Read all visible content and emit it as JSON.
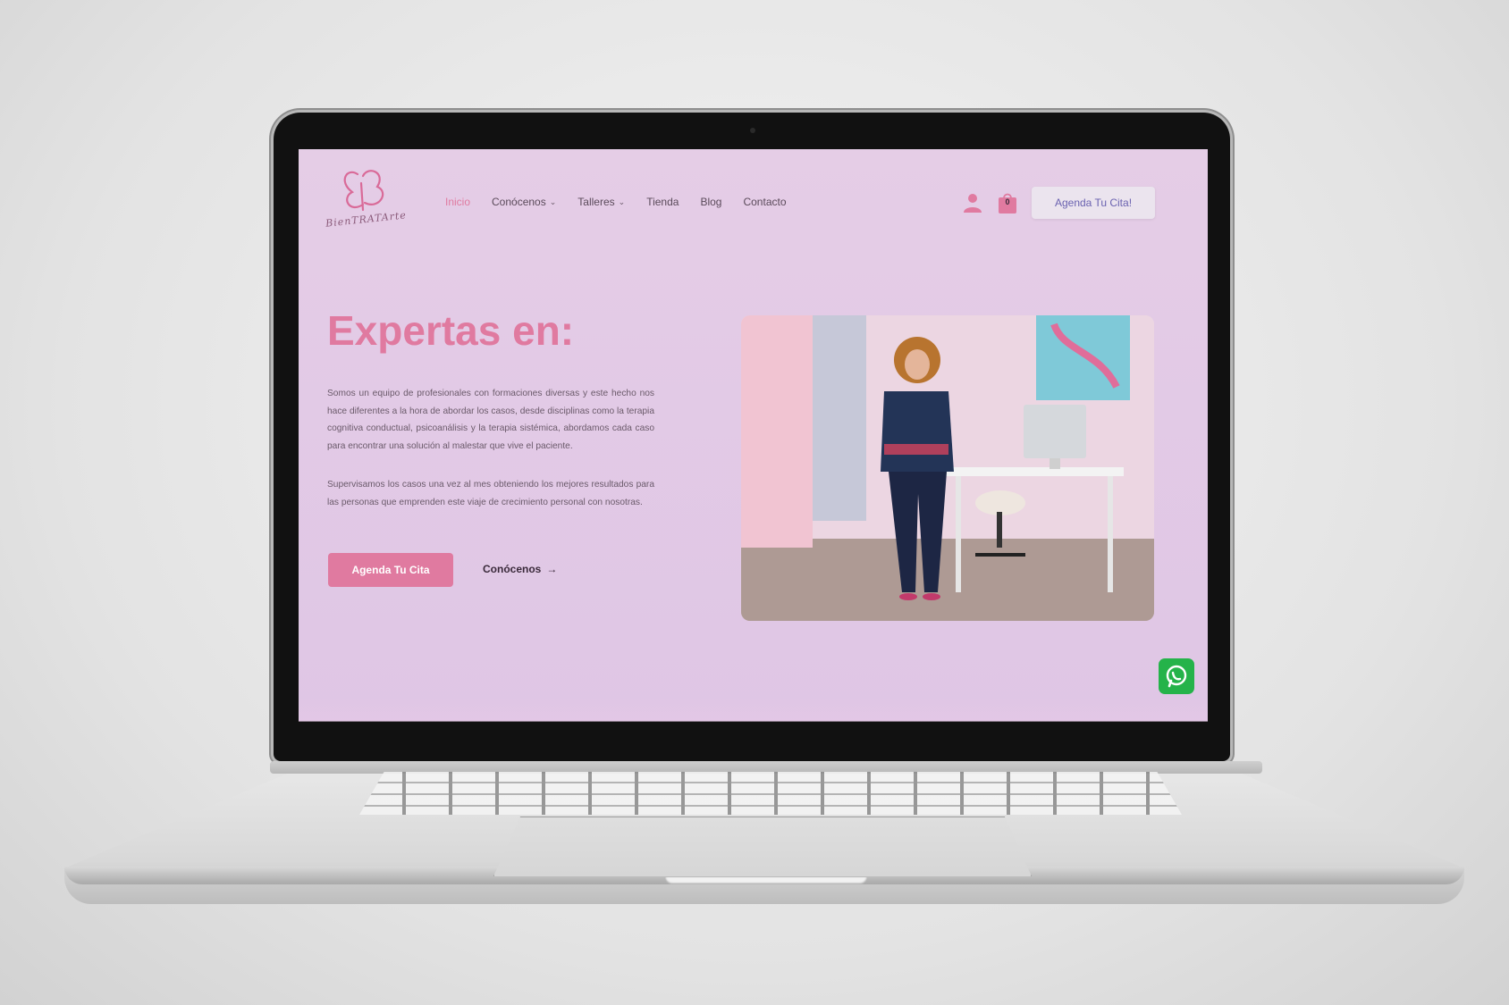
{
  "brand": {
    "logo_text": "BienTRATArte"
  },
  "nav": {
    "items": [
      {
        "label": "Inicio",
        "active": true,
        "has_dropdown": false
      },
      {
        "label": "Conócenos",
        "active": false,
        "has_dropdown": true
      },
      {
        "label": "Talleres",
        "active": false,
        "has_dropdown": true
      },
      {
        "label": "Tienda",
        "active": false,
        "has_dropdown": false
      },
      {
        "label": "Blog",
        "active": false,
        "has_dropdown": false
      },
      {
        "label": "Contacto",
        "active": false,
        "has_dropdown": false
      }
    ],
    "cart_count": "0",
    "cta_label": "Agenda Tu Cita!"
  },
  "hero": {
    "headline": "Expertas en:",
    "paragraph_1": "Somos un equipo de profesionales con formaciones diversas y este hecho nos hace diferentes a la hora de abordar los casos, desde disciplinas como la terapia cognitiva conductual, psicoanálisis y la terapia sistémica, abordamos cada caso para encontrar una solución al malestar que vive el paciente.",
    "paragraph_2": "Supervisamos los casos una vez al mes obteniendo los mejores resultados para las personas que emprenden este viaje de crecimiento personal con nosotras.",
    "primary_button": "Agenda Tu Cita",
    "secondary_link": "Conócenos",
    "arrow": "→"
  },
  "icons": {
    "user": "user-icon",
    "cart": "shopping-bag-icon",
    "whatsapp": "whatsapp-icon",
    "chevron": "chevron-down-icon"
  },
  "colors": {
    "accent": "#e07aa0",
    "background": "#e2cbe6",
    "cta_text": "#6a62b0",
    "whatsapp": "#25b34a"
  }
}
